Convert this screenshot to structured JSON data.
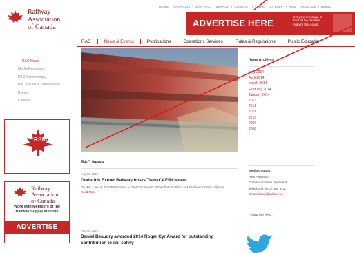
{
  "header": {
    "logo_line1": "Railway Association",
    "logo_line2": "of Canada",
    "utility_links": [
      "HOME",
      "|",
      "FRANÇAIS",
      "|",
      "JOIN RAC",
      "|",
      "SEARCH",
      "|",
      "CONTACT",
      "|",
      "LINKS",
      "|",
      "SITEMAP",
      "|",
      "RSS",
      "|",
      "POLICIES",
      "|",
      "EMAIL"
    ]
  },
  "advert_banner": {
    "title_light": "ADVERTISE",
    "title_bold": "HERE",
    "subtitle": "Get your message in front of the decision makers that count."
  },
  "nav": {
    "items": [
      "RAC",
      "News & Events",
      "Publications",
      "Operations Services",
      "Rules & Regulations",
      "Public Education"
    ],
    "active": "News & Events"
  },
  "sidebar": {
    "items": [
      "RAC News",
      "Media Resources",
      "RAC Commentary",
      "RAC Issues & Submissions",
      "Events",
      "Courses"
    ],
    "active": "RAC News"
  },
  "side_ads": {
    "rsi": {
      "title": "RSI/CMA"
    },
    "rac": {
      "name_line1": "Railway Association",
      "name_line2": "of Canada",
      "work_line1": "Work with Members of the",
      "work_line2": "Railway Supply Institute",
      "cta": "ADVERTISE HERE!"
    }
  },
  "news": {
    "section_title": "RAC News",
    "items": [
      {
        "date": "Aug 20, 2014",
        "headline": "Goderich Exeter Railway hosts TransCAER® event",
        "excerpt": "On May 7 and 8, the GEXR hosted a TransCAER event in their both Stratford and Kitchener Ontario railyards.",
        "more": "Read More"
      },
      {
        "date": "Aug 02, 2014",
        "headline_line1": "Daniel Beaudry awarded 2014 Roger Cyr Award for outstanding",
        "headline_line2": "contribution to rail safety"
      }
    ]
  },
  "archives": {
    "title": "News Archives",
    "items": [
      "May 2014",
      "April 2014",
      "March 2014",
      "February 2014",
      "January 2014",
      "2013",
      "2012",
      "2011",
      "2010",
      "2009",
      "2008"
    ]
  },
  "media_contact": {
    "title": "Media Contact:",
    "name": "Alex Paterson",
    "role": "Communications Specialist",
    "phone": "Telephone: (613) 564 8111",
    "email_label": "Email:",
    "email": "alexp@railcan.ca",
    "follow": "Follow the RAC:"
  },
  "colors": {
    "brand_red": "#c62828"
  }
}
